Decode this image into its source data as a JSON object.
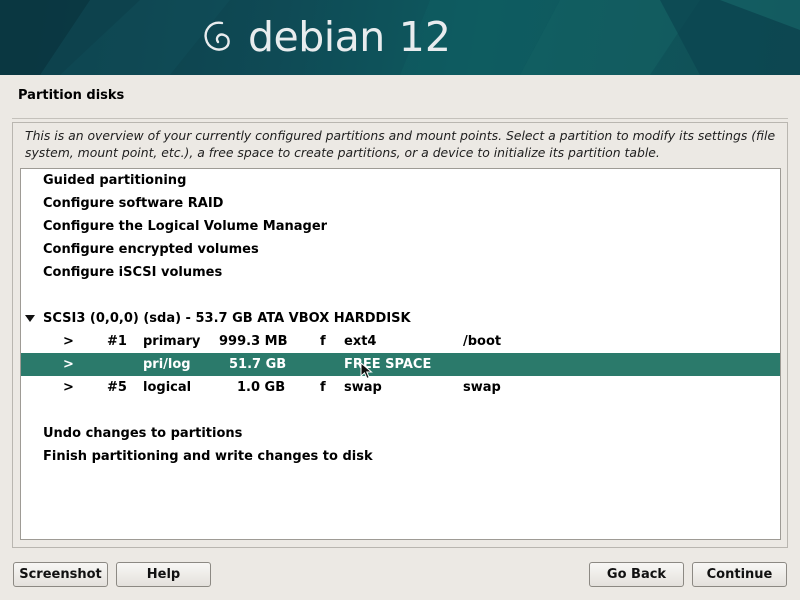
{
  "banner": {
    "brand": "debian",
    "version": "12"
  },
  "page": {
    "title": "Partition disks"
  },
  "description": "This is an overview of your currently configured partitions and mount points. Select a partition to modify its settings (file system, mount point, etc.), a free space to create partitions, or a device to initialize its partition table.",
  "menu": {
    "guided": "Guided partitioning",
    "raid": "Configure software RAID",
    "lvm": "Configure the Logical Volume Manager",
    "encrypted": "Configure encrypted volumes",
    "iscsi": "Configure iSCSI volumes",
    "undo": "Undo changes to partitions",
    "finish": "Finish partitioning and write changes to disk"
  },
  "disk": {
    "label": "SCSI3 (0,0,0) (sda) - 53.7 GB ATA VBOX HARDDISK",
    "partitions": [
      {
        "arrow": ">",
        "num": "#1",
        "type": "primary",
        "size": "999.3 MB",
        "flag": "f",
        "fs": "ext4",
        "mount": "/boot",
        "selected": false
      },
      {
        "arrow": ">",
        "num": "",
        "type": "pri/log",
        "size": "51.7 GB",
        "flag": "",
        "fs": "FREE SPACE",
        "mount": "",
        "selected": true
      },
      {
        "arrow": ">",
        "num": "#5",
        "type": "logical",
        "size": "1.0 GB",
        "flag": "f",
        "fs": "swap",
        "mount": "swap",
        "selected": false
      }
    ]
  },
  "buttons": {
    "screenshot": "Screenshot",
    "help": "Help",
    "back": "Go Back",
    "continue": "Continue"
  },
  "colors": {
    "banner": "#0f4a55",
    "selection": "#2b7a6b",
    "background": "#ece9e4"
  }
}
